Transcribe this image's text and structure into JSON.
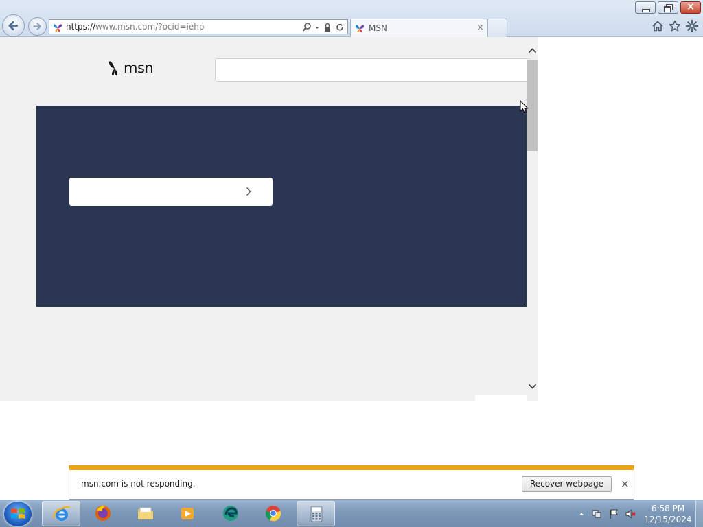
{
  "browser": {
    "address": {
      "scheme": "https://",
      "host": "www.msn.com",
      "path": "/?ocid=iehp"
    },
    "tab": {
      "title": "MSN",
      "close_glyph": "×"
    },
    "window_close_glyph": "×",
    "toolbar_icons": [
      "home-icon",
      "favorites-star-icon",
      "tools-gear-icon"
    ]
  },
  "page": {
    "logo_text": "msn",
    "search_placeholder": "",
    "hero_color": "#2b3652",
    "hero_button_label": ""
  },
  "notification": {
    "message": "msn.com is not responding.",
    "recover_label": "Recover webpage",
    "close_glyph": "×",
    "accent_color": "#e8a317"
  },
  "taskbar": {
    "apps": [
      "internet-explorer",
      "firefox",
      "windows-explorer",
      "media-player",
      "edge",
      "chrome",
      "calculator"
    ],
    "clock": {
      "time": "6:58 PM",
      "date": "12/15/2024"
    }
  }
}
